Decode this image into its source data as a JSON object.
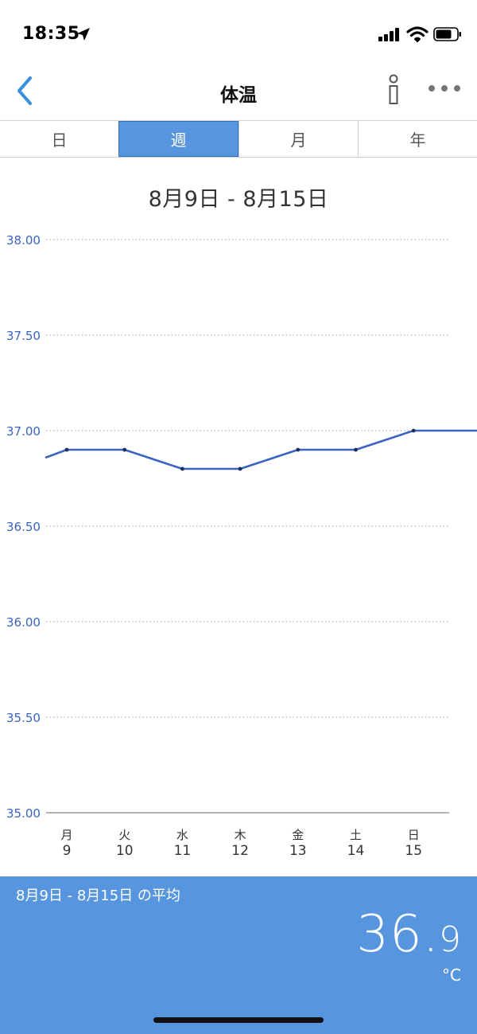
{
  "status_bar": {
    "time": "18:35",
    "icons": [
      "location-arrow-icon",
      "cellular-signal-icon",
      "wifi-icon",
      "battery-icon"
    ]
  },
  "nav": {
    "title": "体温",
    "back_icon": "chevron-left-icon",
    "info_icon": "info-icon",
    "more_icon": "ellipsis-icon"
  },
  "segments": [
    {
      "label": "日",
      "active": false
    },
    {
      "label": "週",
      "active": true
    },
    {
      "label": "月",
      "active": false
    },
    {
      "label": "年",
      "active": false
    }
  ],
  "date_range": "8月9日 - 8月15日",
  "chart_data": {
    "type": "line",
    "title": "",
    "xlabel": "",
    "ylabel": "",
    "ylim": [
      35.0,
      38.0
    ],
    "yticks": [
      "38.00",
      "37.50",
      "37.00",
      "36.50",
      "36.00",
      "35.50",
      "35.00"
    ],
    "categories": [
      {
        "weekday": "月",
        "day": "9"
      },
      {
        "weekday": "火",
        "day": "10"
      },
      {
        "weekday": "水",
        "day": "11"
      },
      {
        "weekday": "木",
        "day": "12"
      },
      {
        "weekday": "金",
        "day": "13"
      },
      {
        "weekday": "土",
        "day": "14"
      },
      {
        "weekday": "日",
        "day": "15"
      }
    ],
    "series": [
      {
        "values": [
          36.9,
          36.9,
          36.8,
          36.8,
          36.9,
          36.9,
          37.0
        ]
      }
    ],
    "line_extends_past_edges": true,
    "grid": true,
    "colors": {
      "line": "#3b63c0",
      "point": "#1f2f5a",
      "tick_label": "#3b63c0",
      "grid": "#999999"
    }
  },
  "summary": {
    "label": "8月9日 - 8月15日 の平均",
    "value_int": "36",
    "value_dot": ".",
    "value_dec": "9",
    "unit": "°C",
    "background": "#5895df"
  },
  "colors": {
    "accent": "#5895df",
    "back": "#3a8fdc"
  }
}
